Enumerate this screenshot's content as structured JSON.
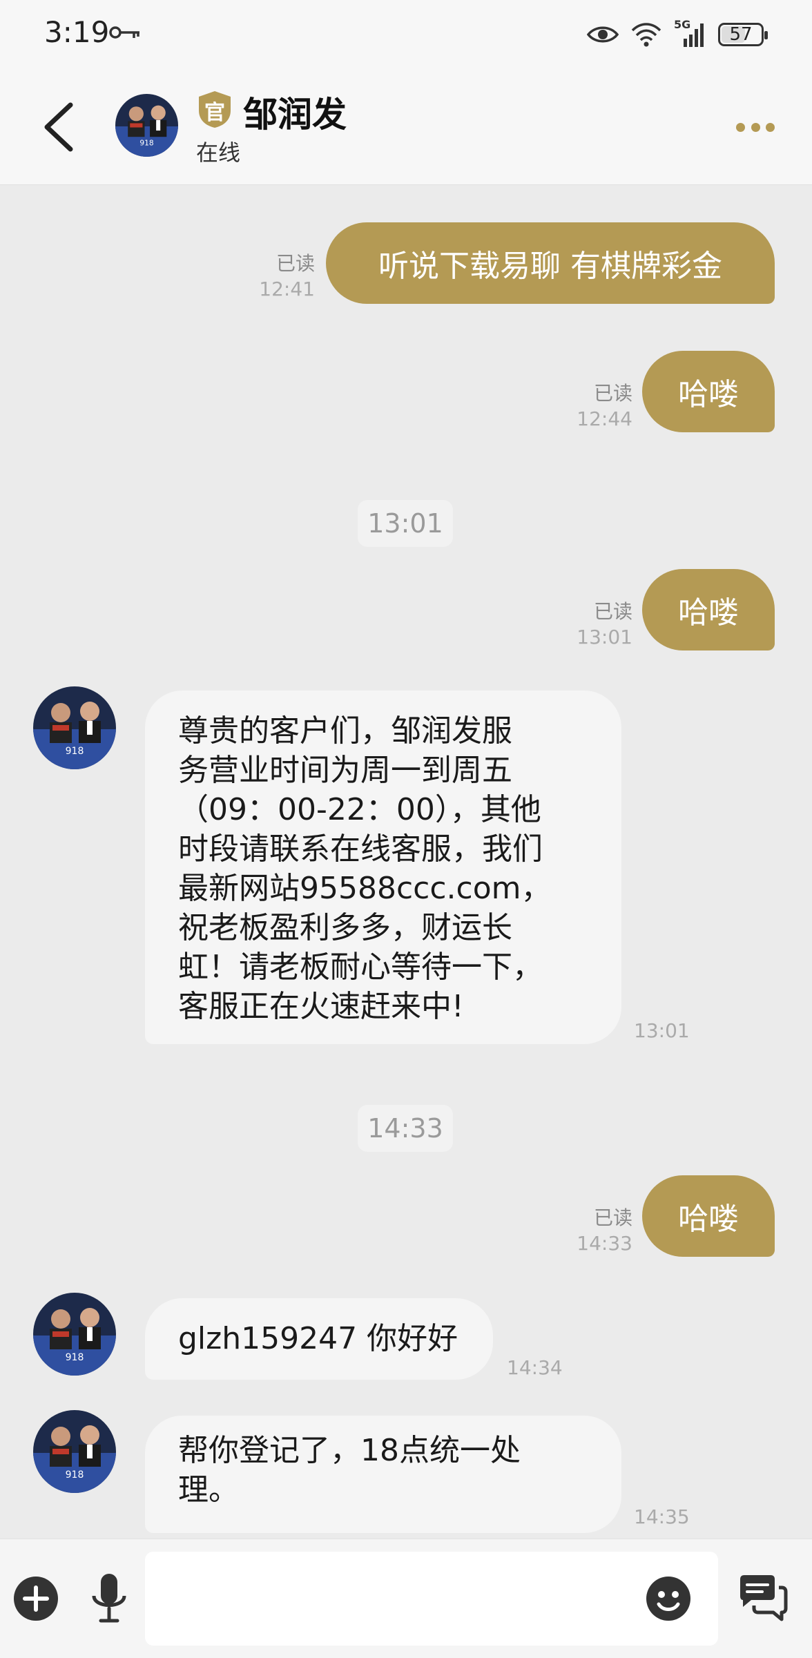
{
  "status_bar": {
    "time": "3:19",
    "battery": "57",
    "network": "5G"
  },
  "header": {
    "back_icon": "chevron-left-icon",
    "contact_name": "邹润发",
    "official_badge": "官",
    "status": "在线",
    "more_icon": "more-dots-icon",
    "accent_color": "#b49a54"
  },
  "messages": {
    "out1": {
      "text": "听说下载易聊  有棋牌彩金",
      "read": "已读",
      "time": "12:41"
    },
    "out2": {
      "text": "哈喽",
      "read": "已读",
      "time": "12:44"
    },
    "sep1": "13:01",
    "out3": {
      "text": "哈喽",
      "read": "已读",
      "time": "13:01"
    },
    "in1": {
      "lines": [
        "尊贵的客户们，邹润发服",
        "务营业时间为周一到周五",
        "（09：00-22：00），其他",
        "时段请联系在线客服，我们",
        "最新网站95588ccc.com，",
        "祝老板盈利多多，财运长",
        "虹！请老板耐心等待一下，",
        "客服正在火速赶来中!"
      ],
      "time": "13:01"
    },
    "sep2": "14:33",
    "out4": {
      "text": "哈喽",
      "read": "已读",
      "time": "14:33"
    },
    "in2": {
      "text": "glzh159247 你好好",
      "time": "14:34"
    },
    "in3": {
      "lines": [
        "帮你登记了，18点统一处",
        "理。"
      ],
      "time": "14:35"
    }
  },
  "input_bar": {
    "placeholder": "",
    "value": ""
  }
}
